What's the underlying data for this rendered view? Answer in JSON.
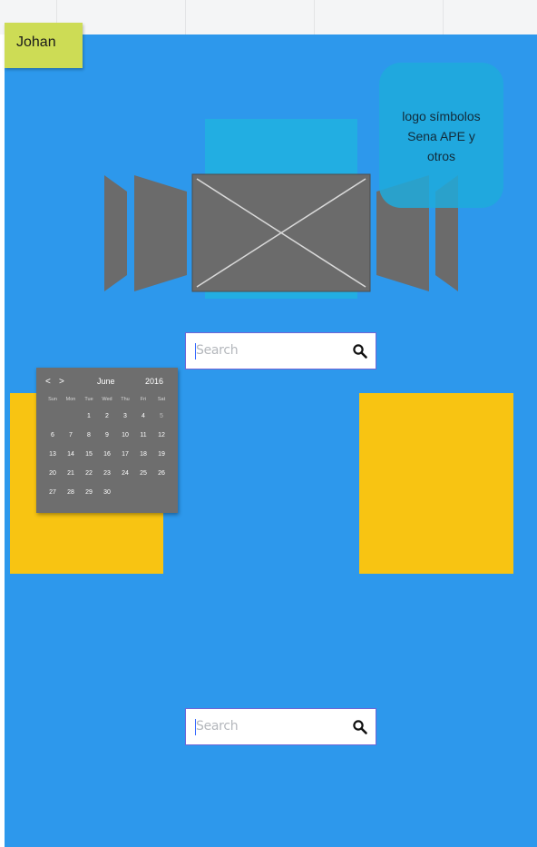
{
  "sticky_note": {
    "text": "Johan"
  },
  "callout": {
    "lines": [
      "logo símbolos",
      "Sena APE y",
      "otros"
    ]
  },
  "carousel": {
    "label": ""
  },
  "search_top": {
    "placeholder": "Search"
  },
  "search_bottom": {
    "placeholder": "Search"
  },
  "calendar": {
    "prev": "<",
    "next": ">",
    "month": "June",
    "year": "2016",
    "weekdays": [
      "Sun",
      "Mon",
      "Tue",
      "Wed",
      "Thu",
      "Fri",
      "Sat"
    ],
    "weeks": [
      [
        "",
        "",
        "",
        "1",
        "2",
        "3",
        "4",
        "5"
      ],
      [
        "6",
        "7",
        "8",
        "9",
        "10",
        "11",
        "12"
      ],
      [
        "13",
        "14",
        "15",
        "16",
        "17",
        "18",
        "19"
      ],
      [
        "20",
        "21",
        "22",
        "23",
        "24",
        "25",
        "26"
      ],
      [
        "27",
        "28",
        "29",
        "30",
        "",
        "",
        ""
      ]
    ]
  },
  "colors": {
    "canvas": "#2d98ec",
    "sticky": "#cddc55",
    "callout": "#1eaadc",
    "yellow_block": "#f8c412",
    "calendar_bg": "#6e6e6e",
    "wireframe_gray": "#6b6b6b"
  },
  "icons": {
    "search": "magnifier-icon",
    "image_placeholder": "image-placeholder-icon"
  }
}
